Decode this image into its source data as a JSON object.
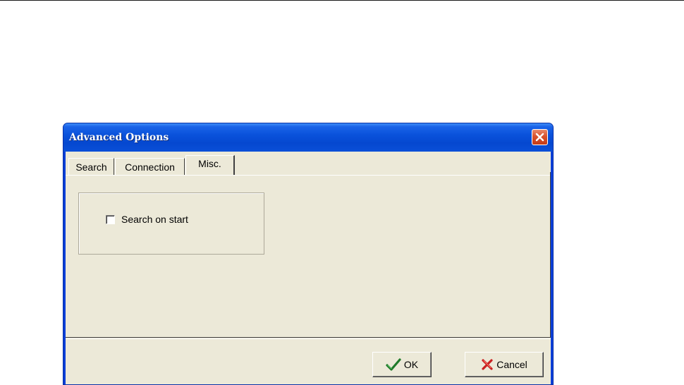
{
  "dialog": {
    "title": "Advanced Options",
    "close_icon": "close-icon",
    "tabs": [
      {
        "label": "Search",
        "active": false
      },
      {
        "label": "Connection",
        "active": false
      },
      {
        "label": "Misc.",
        "active": true
      }
    ],
    "misc": {
      "search_on_start_label": "Search on start",
      "search_on_start_checked": false
    },
    "buttons": {
      "ok_label": "OK",
      "ok_icon": "checkmark-icon",
      "cancel_label": "Cancel",
      "cancel_icon": "red-x-icon"
    }
  },
  "colors": {
    "titlebar": "#0a52db",
    "client_background": "#ece9d8",
    "close_button": "#d9522d",
    "ok_check": "#1f7a2a",
    "cancel_x": "#c82020"
  }
}
